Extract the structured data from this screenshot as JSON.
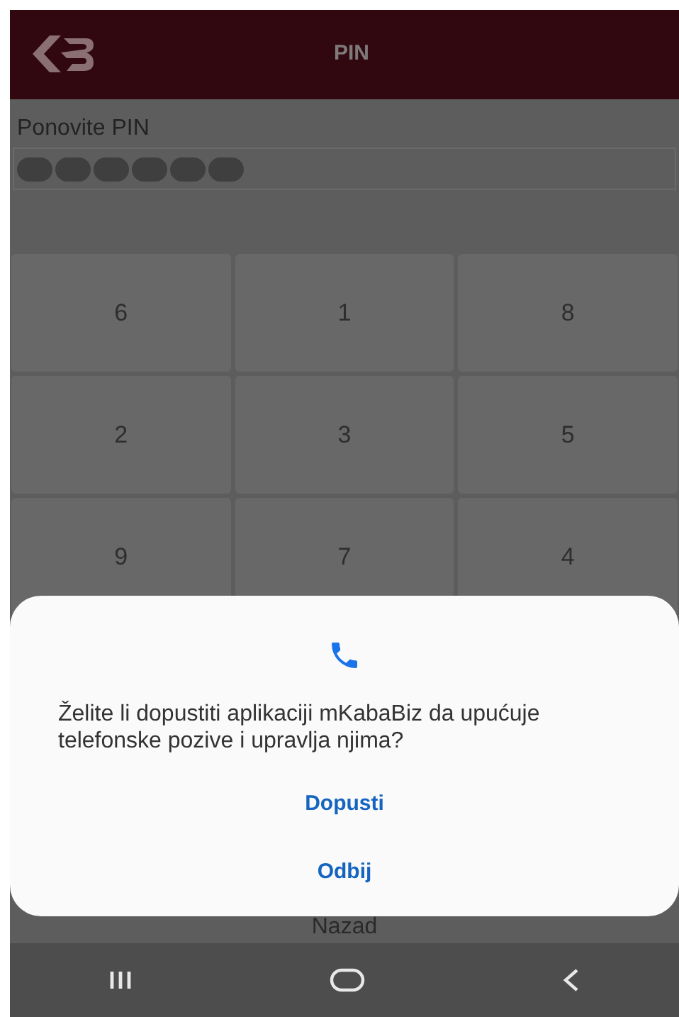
{
  "header": {
    "title": "PIN"
  },
  "pin": {
    "label": "Ponovite PIN",
    "digits": [
      {
        "filled": true
      },
      {
        "filled": true
      },
      {
        "filled": true
      },
      {
        "filled": true
      },
      {
        "filled": true
      },
      {
        "filled": true
      }
    ]
  },
  "keypad": [
    "6",
    "1",
    "8",
    "2",
    "3",
    "5",
    "9",
    "7",
    "4"
  ],
  "back_button": "Nazad",
  "dialog": {
    "message": "Želite li dopustiti aplikaciji mKabaBiz da upućuje telefonske pozive i upravlja njima?",
    "buttons": [
      "Dopusti",
      "Odbij"
    ]
  }
}
